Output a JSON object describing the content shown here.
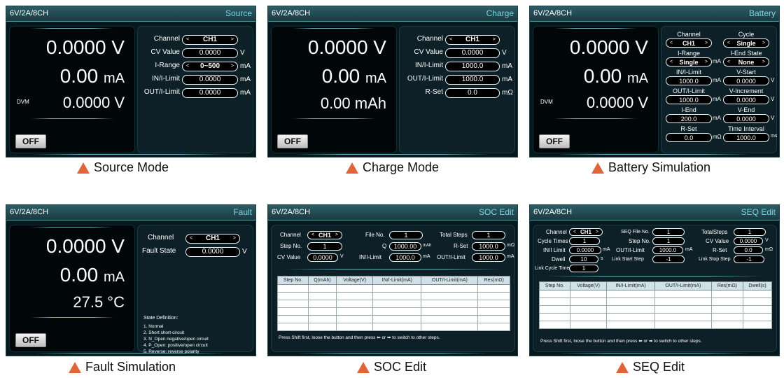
{
  "model": "6V/2A/8CH",
  "colors": {
    "accent": "#e0653a",
    "screen_bg": "#04181d",
    "title_text": "#7ed3e3"
  },
  "arrows": {
    "left": "<",
    "right": ">"
  },
  "off_label": "OFF",
  "dvm_label": "DVM",
  "source": {
    "mode": "Source",
    "voltage": "0.0000 V",
    "current_num": "0.00",
    "current_unit": "mA",
    "dvm_value": "0.0000  V",
    "fields": [
      {
        "label": "Channel",
        "value": "CH1",
        "unit": ""
      },
      {
        "label": "CV Value",
        "value": "0.0000",
        "unit": "V"
      },
      {
        "label": "I-Range",
        "value": "0~500",
        "unit": "mA"
      },
      {
        "label": "IN/I-Limit",
        "value": "0.0000",
        "unit": "mA"
      },
      {
        "label": "OUT/I-Limit",
        "value": "0.0000",
        "unit": "mA"
      }
    ],
    "caption": "Source  Mode"
  },
  "charge": {
    "mode": "Charge",
    "voltage": "0.0000 V",
    "current_num": "0.00",
    "current_unit": "mA",
    "capacity": "0.00 mAh",
    "fields": [
      {
        "label": "Channel",
        "value": "CH1",
        "unit": ""
      },
      {
        "label": "CV Value",
        "value": "0.0000",
        "unit": "V"
      },
      {
        "label": "IN/I-Limit",
        "value": "1000.0",
        "unit": "mA"
      },
      {
        "label": "OUT/I-Limit",
        "value": "1000.0",
        "unit": "mA"
      },
      {
        "label": "R-Set",
        "value": "0.0",
        "unit": "mΩ"
      }
    ],
    "caption": "Charge Mode"
  },
  "battery": {
    "mode": "Battery",
    "voltage": "0.0000 V",
    "current_num": "0.00",
    "current_unit": "mA",
    "dvm_value": "0.0000  V",
    "fields": [
      {
        "label": "Channel",
        "value": "CH1",
        "unit": ""
      },
      {
        "label": "Cycle",
        "value": "Single",
        "unit": ""
      },
      {
        "label": "I-Range",
        "value": "Single",
        "unit": "mA"
      },
      {
        "label": "I-End State",
        "value": "None",
        "unit": ""
      },
      {
        "label": "IN/I-Limit",
        "value": "1000.0",
        "unit": "mA"
      },
      {
        "label": "V-Start",
        "value": "0.0000",
        "unit": "V"
      },
      {
        "label": "OUT/I-Limit",
        "value": "1000.0",
        "unit": "mA"
      },
      {
        "label": "V-Increment",
        "value": "0.0000",
        "unit": "V"
      },
      {
        "label": "I-End",
        "value": "200.0",
        "unit": "mA"
      },
      {
        "label": "V-End",
        "value": "0.0000",
        "unit": "V"
      },
      {
        "label": "R-Set",
        "value": "0.0",
        "unit": "mΩ"
      },
      {
        "label": "Time Interval",
        "value": "1000.0",
        "unit": "ms"
      }
    ],
    "caption": "Battery Simulation"
  },
  "fault": {
    "mode": "Fault",
    "voltage": "0.0000 V",
    "current_num": "0.00",
    "current_unit": "mA",
    "temperature": "27.5  °C",
    "fields": [
      {
        "label": "Channel",
        "value": "CH1",
        "unit": ""
      },
      {
        "label": "Fault State",
        "value": "0.0000",
        "unit": "V"
      }
    ],
    "state_title": "State Definition:",
    "states": [
      "1. Normal",
      "2. Short short-circuit",
      "3. N_Open negative/open circuit",
      "4. P_Open: positive/open circuit",
      "5. Reverse: reverse polarity"
    ],
    "caption": "Fault Simulation"
  },
  "soc": {
    "mode": "SOC Edit",
    "fields": [
      {
        "label": "Channel",
        "value": "CH1",
        "unit": ""
      },
      {
        "label": "File No.",
        "value": "1",
        "unit": ""
      },
      {
        "label": "Total Steps",
        "value": "1",
        "unit": ""
      },
      {
        "label": "Step No.",
        "value": "1",
        "unit": ""
      },
      {
        "label": "Q",
        "value": "1000.00",
        "unit": "mAh"
      },
      {
        "label": "R-Set",
        "value": "1000.0",
        "unit": "mΩ"
      },
      {
        "label": "CV Value",
        "value": "0.0000",
        "unit": "V"
      },
      {
        "label": "IN/I-Limit",
        "value": "1000.0",
        "unit": "mA"
      },
      {
        "label": "OUT/I-Limit",
        "value": "1000.0",
        "unit": "mA"
      }
    ],
    "columns": [
      "Step No.",
      "Q(mAh)",
      "Voltage(V)",
      "IN/I-Limit(mA)",
      "OUT/I-Limit(mA)",
      "Res(mΩ)"
    ],
    "hint": "Press Shift first, loose the button and then press ⬅ or ➡ to switch to other steps.",
    "caption": "SOC Edit"
  },
  "seq": {
    "mode": "SEQ Edit",
    "fields": [
      {
        "label": "Channel",
        "value": "CH1",
        "unit": ""
      },
      {
        "label": "SEQ File No.",
        "value": "1",
        "unit": ""
      },
      {
        "label": "TotalSteps",
        "value": "1",
        "unit": ""
      },
      {
        "label": "Cycle Times",
        "value": "1",
        "unit": ""
      },
      {
        "label": "Step No.",
        "value": "1",
        "unit": ""
      },
      {
        "label": "CV Value",
        "value": "0.0000",
        "unit": "V"
      },
      {
        "label": "IN/I Limit",
        "value": "0.0000",
        "unit": "mA"
      },
      {
        "label": "OUT/I-Limit",
        "value": "1000.0",
        "unit": "mA"
      },
      {
        "label": "R-Set",
        "value": "0.0",
        "unit": "mΩ"
      },
      {
        "label": "Dwell",
        "value": "10",
        "unit": "s"
      },
      {
        "label": "Link Start Step",
        "value": "-1",
        "unit": ""
      },
      {
        "label": "Link Stop Step",
        "value": "-1",
        "unit": ""
      },
      {
        "label": "Link Cycle Times",
        "value": "1",
        "unit": ""
      }
    ],
    "columns": [
      "Step No.",
      "Voltage(V)",
      "IN/I-Limit(mA)",
      "OUT/I-Limit(mA)",
      "Res(mΩ)",
      "Dwell(s)"
    ],
    "hint": "Press Shift first, loose the button and then press ⬅ or ➡ to switch to other steps.",
    "caption": "SEQ Edit"
  }
}
